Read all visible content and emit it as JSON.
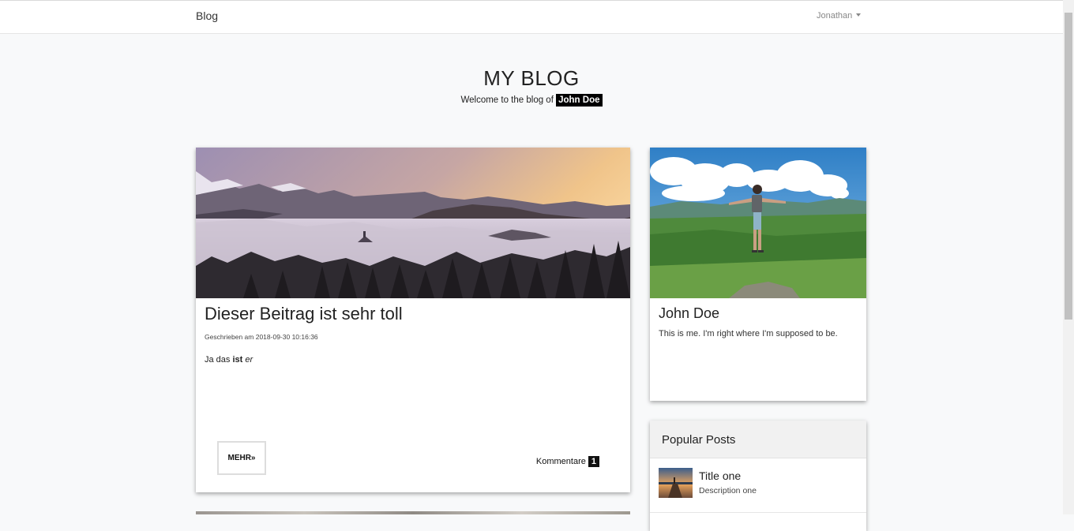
{
  "navbar": {
    "brand": "Blog",
    "user": "Jonathan"
  },
  "hero": {
    "title": "MY BLOG",
    "subtitle_prefix": "Welcome to the blog of",
    "author": "John Doe"
  },
  "post": {
    "title": "Dieser Beitrag ist sehr toll",
    "date": "Geschrieben am 2018-09-30 10:16:36",
    "body_plain": "Ja das",
    "body_bold": "ist",
    "body_italic": "er",
    "more_label": "MEHR»",
    "comments_label": "Kommentare",
    "comments_count": "1"
  },
  "profile": {
    "name": "John Doe",
    "description": "This is me. I'm right where I'm supposed to be."
  },
  "popular": {
    "heading": "Popular Posts",
    "items": [
      {
        "title": "Title one",
        "description": "Description one"
      }
    ]
  },
  "colors": {
    "page_bg": "#f8f9fa",
    "badge_bg": "#000000"
  },
  "icons": {
    "user_menu": "caret-down-icon"
  }
}
